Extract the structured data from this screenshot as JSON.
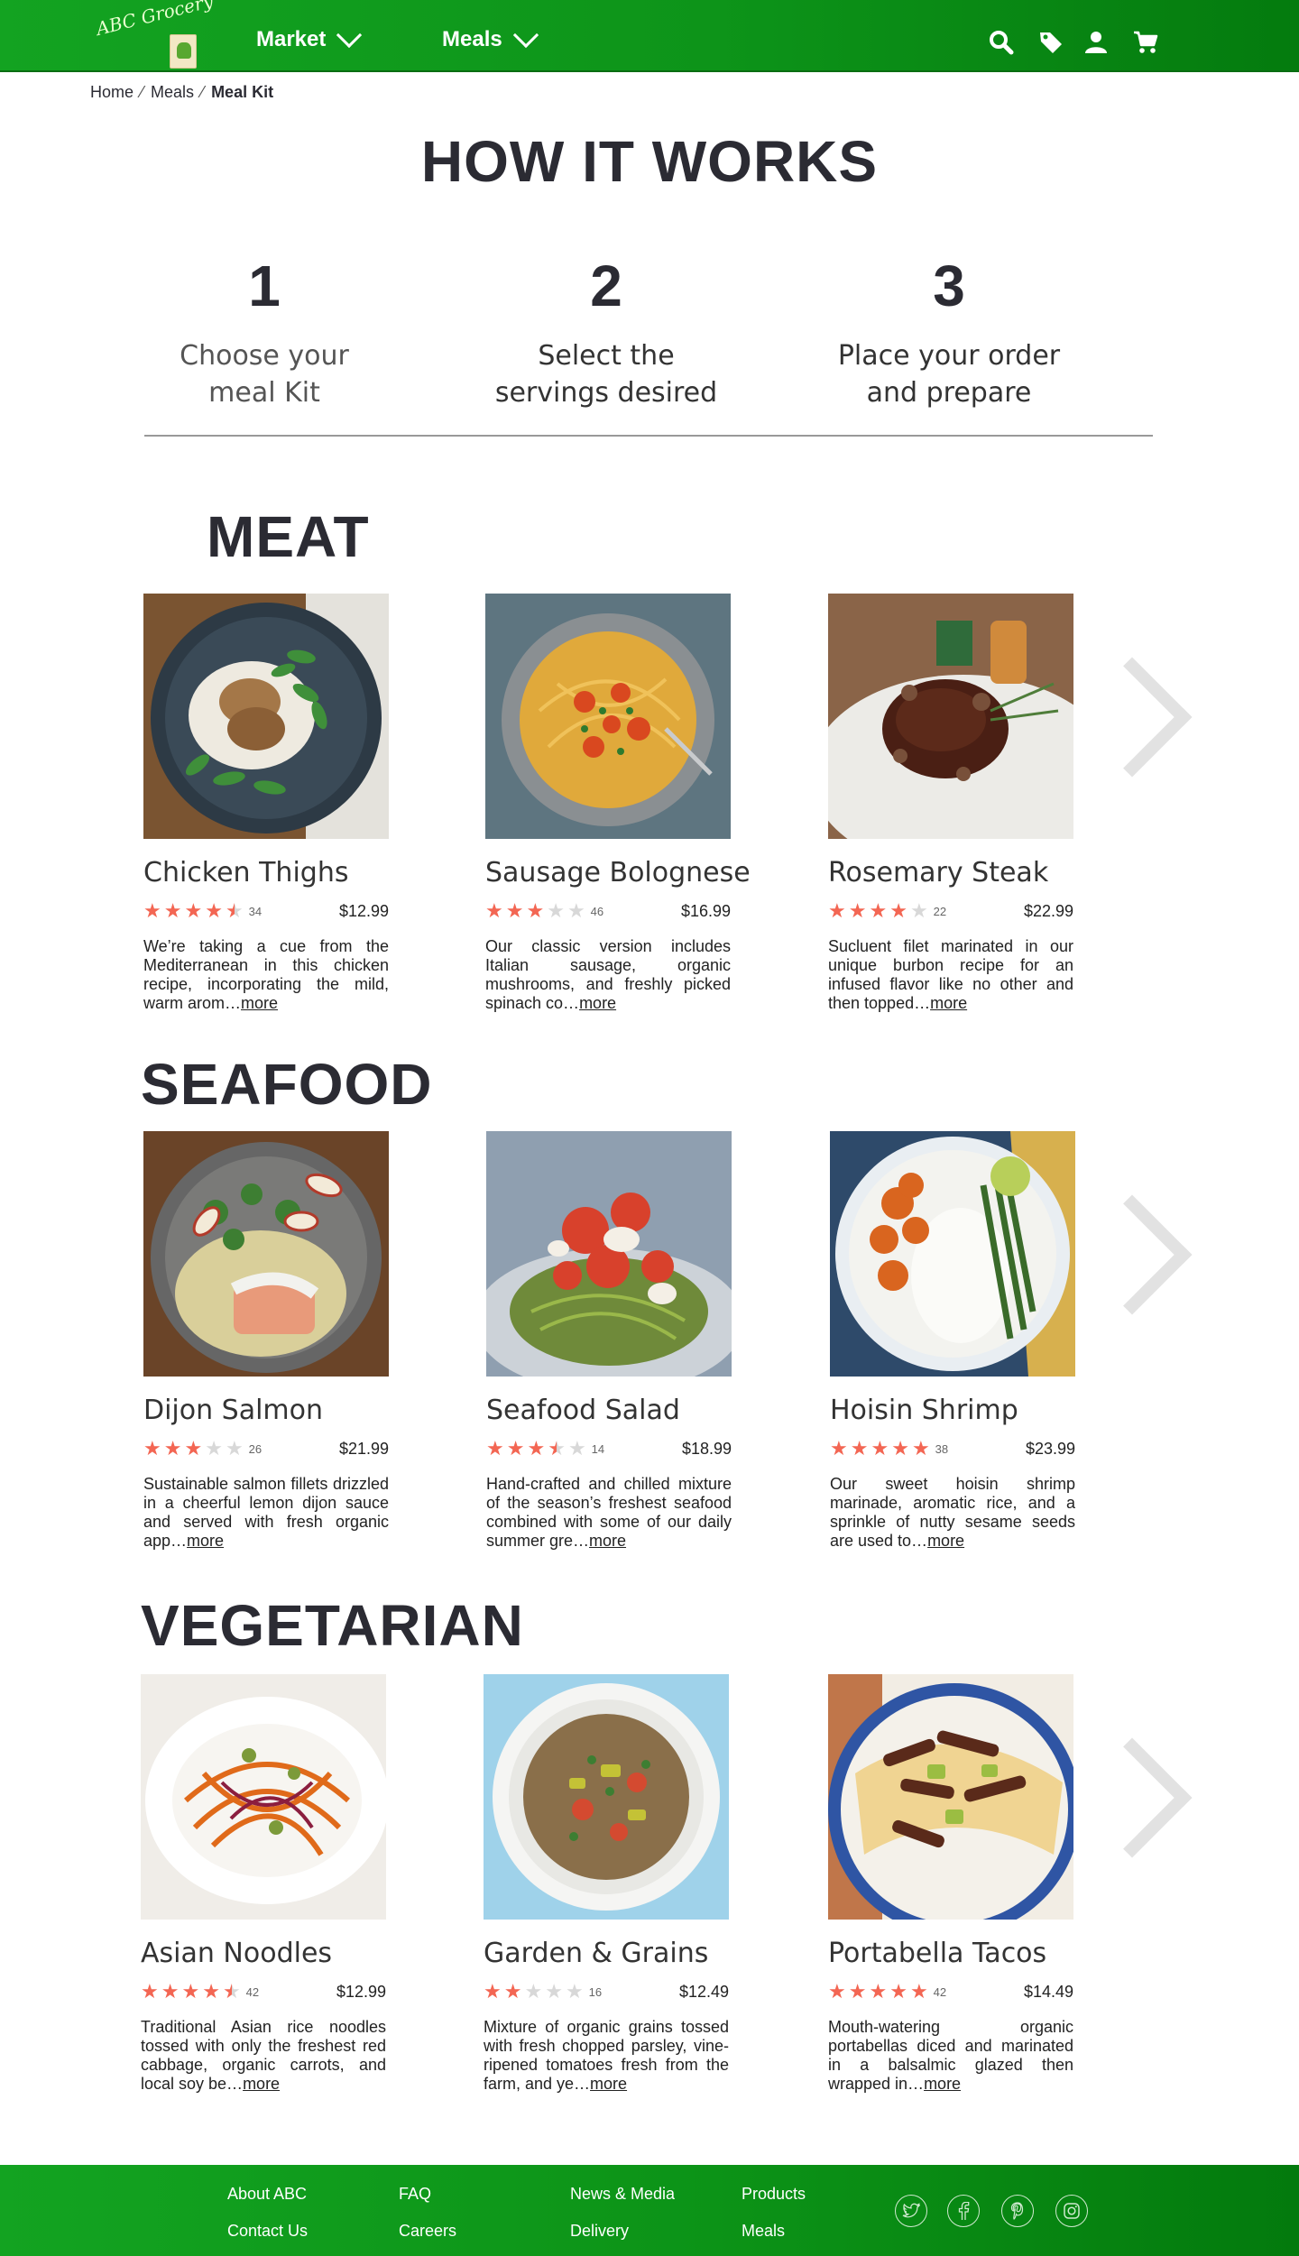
{
  "header": {
    "logo_text": "ABC Grocery",
    "nav": [
      {
        "label": "Market"
      },
      {
        "label": "Meals"
      }
    ],
    "icons": [
      "search-icon",
      "tag-icon",
      "user-icon",
      "cart-icon"
    ]
  },
  "breadcrumb": {
    "items": [
      "Home",
      "Meals",
      "Meal Kit"
    ]
  },
  "how": {
    "title": "HOW IT WORKS",
    "steps": [
      {
        "num": "1",
        "line1": "Choose your",
        "line2": "meal Kit"
      },
      {
        "num": "2",
        "line1": "Select the",
        "line2": "servings desired"
      },
      {
        "num": "3",
        "line1": "Place your order",
        "line2": "and prepare"
      }
    ]
  },
  "sections": [
    {
      "title": "MEAT",
      "items": [
        {
          "name": "Chicken Thighs",
          "rating": 4.5,
          "reviews": "34",
          "price": "$12.99",
          "blurb": "We’re taking a cue from the Mediterranean in this chicken recipe, incorporating the mild, warm arom…",
          "more": "more"
        },
        {
          "name": "Sausage Bolognese",
          "rating": 3,
          "reviews": "46",
          "price": "$16.99",
          "blurb": "Our classic version includes Italian sausage, organic mushrooms, and freshly picked spinach co…",
          "more": "more"
        },
        {
          "name": "Rosemary Steak",
          "rating": 4,
          "reviews": "22",
          "price": "$22.99",
          "blurb": "Sucluent filet marinated in our unique burbon recipe for an infused flavor like no other and then topped…",
          "more": "more"
        }
      ]
    },
    {
      "title": "SEAFOOD",
      "items": [
        {
          "name": "Dijon Salmon",
          "rating": 3,
          "reviews": "26",
          "price": "$21.99",
          "blurb": "Sustainable salmon fillets drizzled in a cheerful lemon dijon sauce and served with fresh organic app…",
          "more": "more"
        },
        {
          "name": "Seafood Salad",
          "rating": 3.5,
          "reviews": "14",
          "price": "$18.99",
          "blurb": "Hand-crafted and chilled mixture of the season’s freshest seafood combined with some of our daily summer gre…",
          "more": "more"
        },
        {
          "name": "Hoisin Shrimp",
          "rating": 5,
          "reviews": "38",
          "price": "$23.99",
          "blurb": "Our sweet hoisin shrimp marinade, aromatic rice, and a sprinkle of nutty sesame seeds are used to…",
          "more": "more"
        }
      ]
    },
    {
      "title": "VEGETARIAN",
      "items": [
        {
          "name": "Asian Noodles",
          "rating": 4.5,
          "reviews": "42",
          "price": "$12.99",
          "blurb": "Traditional Asian rice noodles tossed with only the freshest red cabbage, organic carrots, and local soy be…",
          "more": "more"
        },
        {
          "name": "Garden & Grains",
          "rating": 2,
          "reviews": "16",
          "price": "$12.49",
          "blurb": "Mixture of organic grains tossed with fresh chopped parsley, vine-ripened tomatoes fresh from the farm, and ye…",
          "more": "more"
        },
        {
          "name": "Portabella Tacos",
          "rating": 5,
          "reviews": "42",
          "price": "$14.49",
          "blurb": "Mouth-watering organic portabellas diced and marinated in a balsalmic glazed then wrapped in…",
          "more": "more"
        }
      ]
    }
  ],
  "footer": {
    "links": [
      [
        "About ABC",
        "Contact Us"
      ],
      [
        "FAQ",
        "Careers"
      ],
      [
        "News & Media",
        "Delivery"
      ],
      [
        "Products",
        "Meals"
      ]
    ],
    "social": [
      "twitter-icon",
      "facebook-icon",
      "pinterest-icon",
      "instagram-icon"
    ]
  },
  "colors": {
    "header_green": "#0d9419",
    "star_active": "#f36653",
    "star_inactive": "#d8d8d8"
  }
}
